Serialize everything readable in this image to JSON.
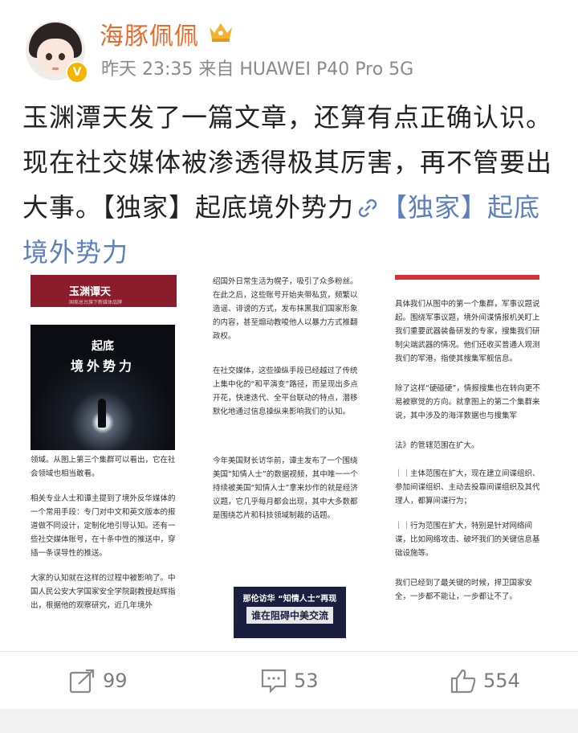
{
  "user": {
    "name": "海豚佩佩",
    "verified_badge": "V",
    "meta": "昨天 23:35 来自 HUAWEI P40 Pro 5G"
  },
  "post": {
    "text_main": "玉渊潭天发了一篇文章，还算有点正确认识。现在社交媒体被渗透得极其厉害，再不管要出大事。【独家】起底境外势力",
    "link_text": "【独家】起底境外势力"
  },
  "article": {
    "banner_title": "玉渊谭天",
    "banner_sub": "国家总台旗下新媒体品牌",
    "poster_line1": "起底",
    "poster_line2": "境外势力",
    "col1_text_a": "领域。从图上第三个集群可以看出，它在社会领域也相当敢看。",
    "col1_text_b": "相关专业人士和谭主提到了境外反华媒体的一个常用手段：专门对中文和英文版本的报道做不同设计，定制化地引导认知。还有一些社交媒体账号，在十条中性的推送中，穿插一条误导性的推送。",
    "col1_text_c": "大家的认知就在这样的过程中被影响了。中国人民公安大学国家安全学院副教授赵辉指出，根据他的观察研究，近几年境外",
    "col2_text_a": "绍国外日常生活为幌子，吸引了众多粉丝。在此之后，这些账号开始夹带私货，频繁以造谣、诽谤的方式，发布抹黑我们国家形象的内容，甚至煽动教唆他人以暴力方式推翻政权。",
    "col2_text_b": "在社交媒体，这些操纵手段已经越过了传统上集中化的“和平演变”路径，而呈现出多点开花，快速迭代、全平台联动的特点，潜移默化地通过信息操纵来影响我们的认知。",
    "col2_text_c": "今年美国财长访华前，谭主发布了一个围绕美国“知情人士”的数据视频，其中唯一一个持续被美国“知情人士”拿来炒作的就是经济议题，它几乎每月都会出现，其中大多数都是围绕芯片和科技领域制裁的话题。",
    "video_line1": "那伦访华 “知情人士”再现",
    "video_line2": "谁在阻碍中美交流",
    "col3_text_a": "具体我们从图中的第一个集群，军事议题说起。围绕军事议题，境外间谍情报机关盯上我们重要武器装备研发的专家，搜集我们研制尖端武器的情况。他们还收买普通人观测我们的军港，指使其搜集军舰信息。",
    "col3_text_b": "除了这样“硬碰硬”，情报搜集也在转向更不易被察觉的方向。就拿图上的第二个集群来说，其中涉及的海洋数据也与搜集军",
    "col3_text_c": "法》的管辖范围在扩大。",
    "col3_text_d": "｜｜主体范围在扩大，现在建立间谍组织、参加间谍组织、主动去投靠间谍组织及其代理人，都算间谍行为；",
    "col3_text_e": "｜｜行为范围在扩大，特别是针对网络间谍，比如网络攻击、破坏我们的关键信息基础设施等。",
    "col3_text_f": "我们已经到了最关键的时候，捍卫国家安全，一步都不能让，一步都让不了。"
  },
  "actions": {
    "repost_count": "99",
    "comment_count": "53",
    "like_count": "554"
  },
  "colors": {
    "username": "#e86b2e",
    "link": "#5b7fbf",
    "meta": "#8a8a8a",
    "action": "#7d7d7d"
  },
  "icons": [
    "repost-icon",
    "comment-icon",
    "like-icon",
    "link-icon",
    "vip-crown-icon",
    "verified-icon"
  ]
}
